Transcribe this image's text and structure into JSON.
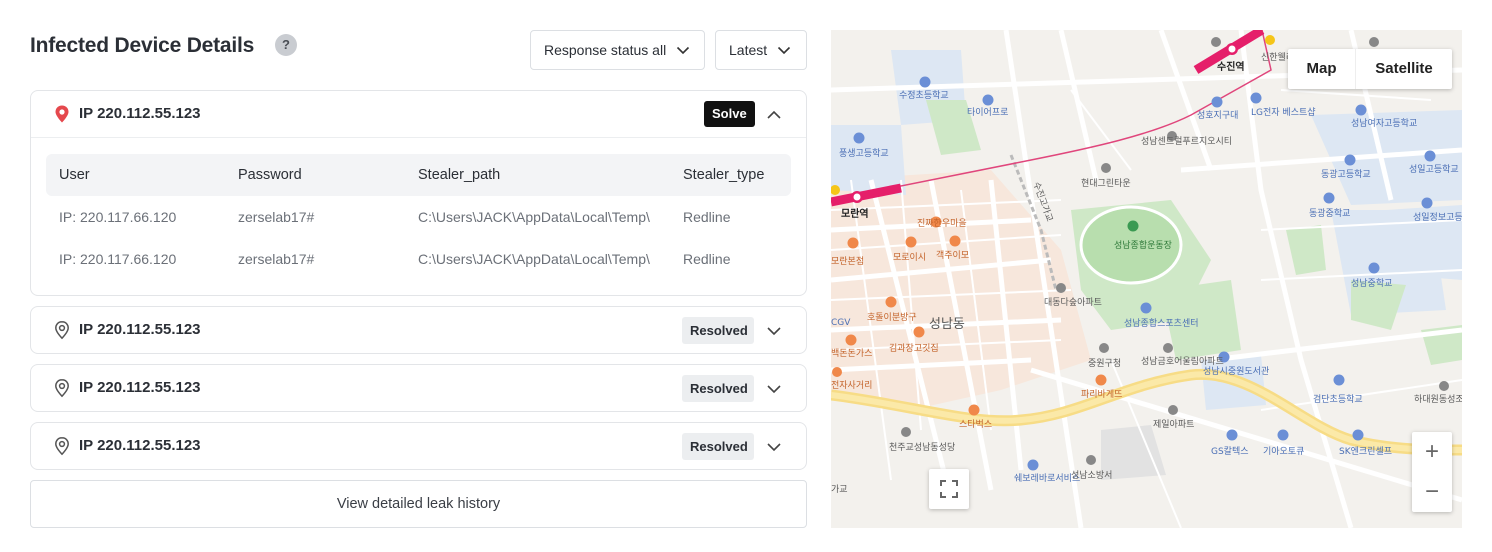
{
  "header": {
    "title": "Infected Device Details",
    "help_glyph": "?",
    "filter_status": "Response status all",
    "filter_sort": "Latest"
  },
  "devices": [
    {
      "ip": "IP 220.112.55.123",
      "status": "Solve",
      "expanded": true,
      "pin_color": "#e5484d",
      "columns": [
        "User",
        "Password",
        "Stealer_path",
        "Stealer_type"
      ],
      "rows": [
        {
          "user": "IP: 220.117.66.120",
          "password": "zerselab17#",
          "path": "C:\\Users\\JACK\\AppData\\Local\\Temp\\",
          "type": "Redline"
        },
        {
          "user": "IP: 220.117.66.120",
          "password": "zerselab17#",
          "path": "C:\\Users\\JACK\\AppData\\Local\\Temp\\",
          "type": "Redline"
        }
      ]
    },
    {
      "ip": "IP 220.112.55.123",
      "status": "Resolved",
      "expanded": false
    },
    {
      "ip": "IP 220.112.55.123",
      "status": "Resolved",
      "expanded": false
    },
    {
      "ip": "IP 220.112.55.123",
      "status": "Resolved",
      "expanded": false
    }
  ],
  "history_button": "View detailed leak history",
  "map": {
    "type_map": "Map",
    "type_satellite": "Satellite",
    "zoom_in": "+",
    "zoom_out": "−",
    "labels": {
      "sujin_station": "수진역",
      "moran_station": "모란역",
      "seongnam_dong": "성남동",
      "sujeong_elementary": "수정초등학교",
      "tire_pro": "타이어프로",
      "sinhan_wedding": "신한웰리웨딩&컨",
      "lg_best": "LG전자 베스트샵",
      "seongho_jigudae": "성호지구대",
      "seongnam_girls": "성남여자고등학교",
      "pungsaeng_high": "풍생고등학교",
      "seongnam_center": "성남센트럴푸르지오시티",
      "hyundai_greentown": "현대그린타운",
      "dongkwang_high": "동광고등학교",
      "dongkwang_middle": "동광중학교",
      "seongil_high": "성일고등학교",
      "seongil_info": "성일정보고등학교",
      "seongnam_stadium": "성남종합운동장",
      "seongnam_middle": "성남중학교",
      "jinjjip_hanu": "진짜한우마을",
      "moran_ilbeon": "모란본점",
      "moro_isi": "모로이시",
      "gyeokjju_imo": "객주이모",
      "daedong_apt": "대동다숲아파트",
      "seongnam_sports": "성남종합스포츠센터",
      "hodol_ibun": "호돌이분방구",
      "kim_jjang": "김과장고깃집",
      "cgv": "CGV",
      "baekdon": "백돈돈가스",
      "jungwon_gu": "중원구청",
      "seongnam_geumho": "성남금호어울림아파트",
      "jungwon_library": "성남시중원도서관",
      "paris": "파리바게뜨",
      "starbucks": "스타벅스",
      "jeil_apt": "제일아파트",
      "geumdan_elementary": "검단초등학교",
      "hadaewon": "하대원동성조원아파트",
      "cheonju_church": "천주교성남동성당",
      "heroes": "쉐보레바로서비스",
      "seongnam_fire": "성남소방서",
      "gs_caltex": "GS칼텍스",
      "kia": "기아오토큐",
      "sk_energy": "SK엔크린셀프",
      "gwanggo": "가교",
      "sujeong_road": "수진고가교",
      "jeonsa": "전자사거리"
    }
  }
}
